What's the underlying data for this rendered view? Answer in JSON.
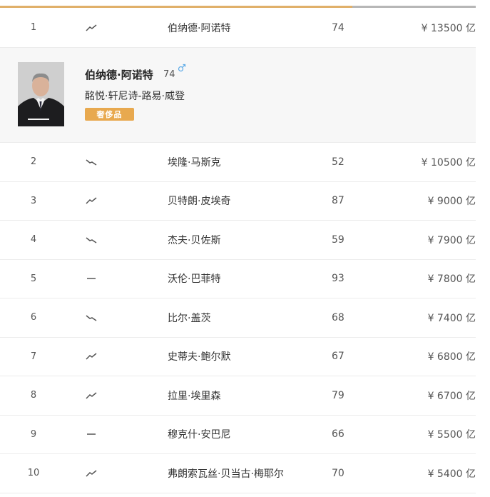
{
  "list": {
    "rows": [
      {
        "rank": "1",
        "trend": "up",
        "name": "伯纳德·阿诺特",
        "age": "74",
        "worth": "¥ 13500 亿"
      },
      {
        "rank": "2",
        "trend": "down",
        "name": "埃隆·马斯克",
        "age": "52",
        "worth": "¥ 10500 亿"
      },
      {
        "rank": "3",
        "trend": "up",
        "name": "贝特朗·皮埃奇",
        "age": "87",
        "worth": "¥ 9000 亿"
      },
      {
        "rank": "4",
        "trend": "down",
        "name": "杰夫·贝佐斯",
        "age": "59",
        "worth": "¥ 7900 亿"
      },
      {
        "rank": "5",
        "trend": "flat",
        "name": "沃伦·巴菲特",
        "age": "93",
        "worth": "¥ 7800 亿"
      },
      {
        "rank": "6",
        "trend": "down",
        "name": "比尔·盖茨",
        "age": "68",
        "worth": "¥ 7400 亿"
      },
      {
        "rank": "7",
        "trend": "up",
        "name": "史蒂夫·鲍尔默",
        "age": "67",
        "worth": "¥ 6800 亿"
      },
      {
        "rank": "8",
        "trend": "up",
        "name": "拉里·埃里森",
        "age": "79",
        "worth": "¥ 6700 亿"
      },
      {
        "rank": "9",
        "trend": "flat",
        "name": "穆克什·安巴尼",
        "age": "66",
        "worth": "¥ 5500 亿"
      },
      {
        "rank": "10",
        "trend": "up",
        "name": "弗朗索瓦丝·贝当古·梅耶尔",
        "age": "70",
        "worth": "¥ 5400 亿"
      }
    ]
  },
  "detail": {
    "name": "伯纳德·阿诺特",
    "age": "74",
    "gender_icon": "male-icon",
    "company": "酩悦·轩尼诗-路易·威登",
    "industry": "奢侈品"
  },
  "colors": {
    "accent": "#e0b06a",
    "badge": "#e8a94f",
    "gender": "#5aa9e6",
    "detail_bg": "#f7f7f7"
  }
}
